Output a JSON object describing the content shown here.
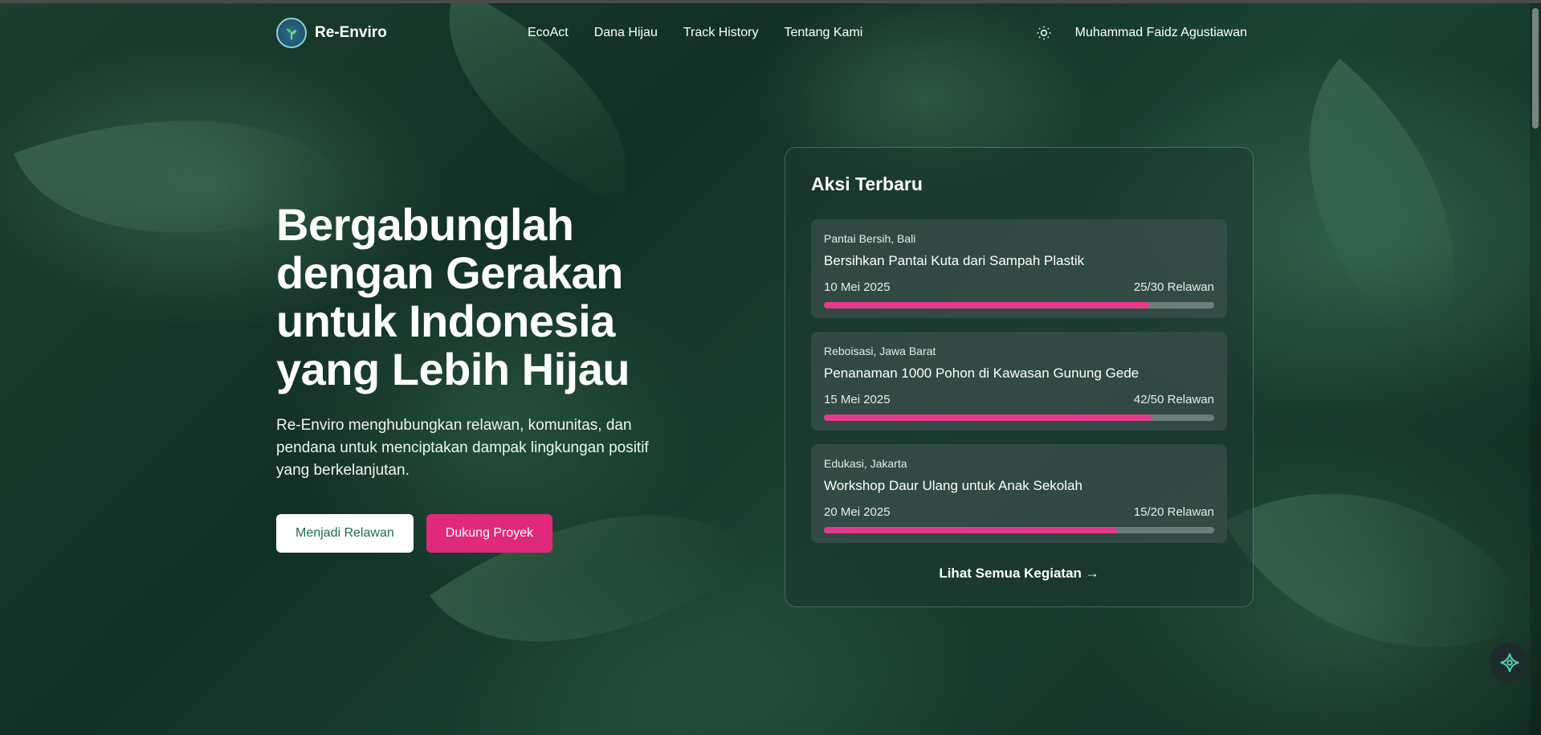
{
  "brand": {
    "name": "Re-Enviro"
  },
  "nav": {
    "items": [
      "EcoAct",
      "Dana Hijau",
      "Track History",
      "Tentang Kami"
    ]
  },
  "user": {
    "name": "Muhammad Faidz Agustiawan"
  },
  "hero": {
    "title": "Bergabunglah dengan Gerakan untuk Indonesia yang Lebih Hijau",
    "subtitle": "Re-Enviro menghubungkan relawan, komunitas, dan pendana untuk menciptakan dampak lingkungan positif yang berkelanjutan.",
    "primary_label": "Menjadi Relawan",
    "secondary_label": "Dukung Proyek"
  },
  "panel": {
    "title": "Aksi Terbaru",
    "cards": [
      {
        "location": "Pantai Bersih, Bali",
        "title": "Bersihkan Pantai Kuta dari Sampah Plastik",
        "date": "10 Mei 2025",
        "volunteers": "25/30 Relawan",
        "progress": 0.833
      },
      {
        "location": "Reboisasi, Jawa Barat",
        "title": "Penanaman 1000 Pohon di Kawasan Gunung Gede",
        "date": "15 Mei 2025",
        "volunteers": "42/50 Relawan",
        "progress": 0.84
      },
      {
        "location": "Edukasi, Jakarta",
        "title": "Workshop Daur Ulang untuk Anak Sekolah",
        "date": "20 Mei 2025",
        "volunteers": "15/20 Relawan",
        "progress": 0.75
      }
    ],
    "see_all": "Lihat Semua Kegiatan →"
  },
  "colors": {
    "accent": "#e0297b",
    "progress": "#e6398a",
    "primary_text": "#1f6b4a"
  },
  "icons": {
    "logo": "globe-plant-icon",
    "theme": "sun-icon",
    "assistant": "sparkle-icon"
  }
}
